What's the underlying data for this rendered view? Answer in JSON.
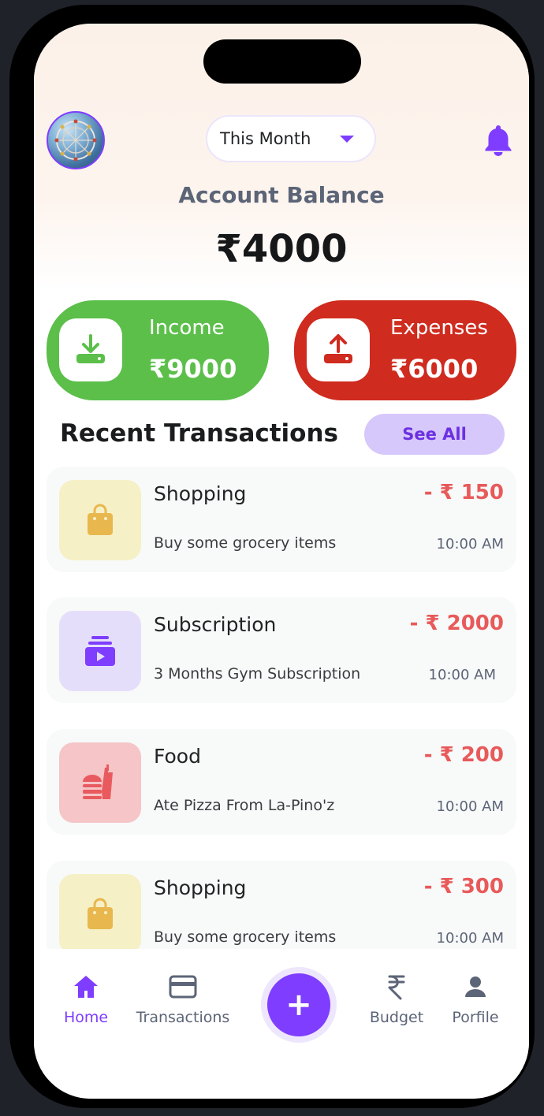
{
  "header": {
    "period_selector": "This Month",
    "notification_icon": "bell-icon"
  },
  "balance": {
    "label": "Account Balance",
    "amount": "₹4000"
  },
  "summary": {
    "income": {
      "label": "Income",
      "amount": "₹9000",
      "icon": "download-tray-icon",
      "color": "#5bbf4a"
    },
    "expenses": {
      "label": "Expenses",
      "amount": "₹6000",
      "icon": "upload-tray-icon",
      "color": "#cf2b1f"
    }
  },
  "recent": {
    "title": "Recent Transactions",
    "see_all": "See All",
    "items": [
      {
        "category": "Shopping",
        "description": "Buy some grocery items",
        "amount": "- ₹ 150",
        "time": "10:00 AM",
        "icon": "shopping-bag-icon"
      },
      {
        "category": "Subscription",
        "description": "3 Months Gym Subscription",
        "amount": "- ₹ 2000",
        "time": "10:00 AM",
        "icon": "subscription-icon"
      },
      {
        "category": "Food",
        "description": "Ate Pizza From La-Pino'z",
        "amount": "- ₹ 200",
        "time": "10:00 AM",
        "icon": "fastfood-icon"
      },
      {
        "category": "Shopping",
        "description": "Buy some grocery items",
        "amount": "- ₹ 300",
        "time": "10:00 AM",
        "icon": "shopping-bag-icon"
      }
    ]
  },
  "nav": {
    "home": "Home",
    "transactions": "Transactions",
    "add": "+",
    "budget": "Budget",
    "profile": "Porfile",
    "active": "home",
    "accent": "#7f3dff"
  }
}
